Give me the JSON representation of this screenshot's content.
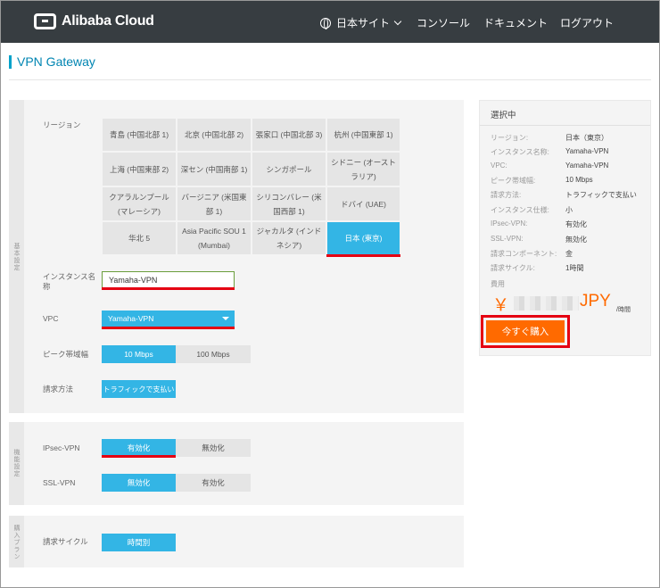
{
  "header": {
    "logo": "Alibaba Cloud",
    "nav": {
      "site": "日本サイト",
      "console": "コンソール",
      "docs": "ドキュメント",
      "logout": "ログアウト"
    }
  },
  "page_title": "VPN Gateway",
  "basic": {
    "section": "基本設定",
    "region_label": "リージョン",
    "regions": [
      "青島 (中国北部 1)",
      "北京 (中国北部 2)",
      "張家口 (中国北部 3)",
      "杭州 (中国東部 1)",
      "上海 (中国東部 2)",
      "深セン (中国南部 1)",
      "シンガポール",
      "シドニー (オーストラリア)",
      "クアラルンプール (マレーシア)",
      "バージニア (米国東部 1)",
      "シリコンバレー (米国西部 1)",
      "ドバイ (UAE)",
      "华北 5",
      "Asia Pacific SOU 1 (Mumbai)",
      "ジャカルタ (インドネシア)",
      "日本 (東京)"
    ],
    "selected_region": "日本 (東京)",
    "instance_label": "インスタンス名称",
    "instance_value": "Yamaha-VPN",
    "vpc_label": "VPC",
    "vpc_value": "Yamaha-VPN",
    "bandwidth_label": "ピーク帯域幅",
    "bandwidth_options": [
      "10 Mbps",
      "100 Mbps"
    ],
    "billing_label": "請求方法",
    "billing_value": "トラフィックで支払い"
  },
  "features": {
    "section": "機能設定",
    "ipsec_label": "IPsec-VPN",
    "ipsec_on": "有効化",
    "ipsec_off": "無効化",
    "ssl_label": "SSL-VPN",
    "ssl_off": "無効化",
    "ssl_on": "有効化"
  },
  "plan": {
    "section": "購入プラン",
    "cycle_label": "請求サイクル",
    "cycle_value": "時間別"
  },
  "summary": {
    "title": "選択中",
    "rows": [
      {
        "k": "リージョン:",
        "v": "日本（東京）"
      },
      {
        "k": "インスタンス名称:",
        "v": "Yamaha-VPN"
      },
      {
        "k": "VPC:",
        "v": "Yamaha-VPN"
      },
      {
        "k": "ピーク帯域幅:",
        "v": "10 Mbps"
      },
      {
        "k": "請求方法:",
        "v": "トラフィックで支払い"
      },
      {
        "k": "インスタンス仕様:",
        "v": "小"
      },
      {
        "k": "IPsec-VPN:",
        "v": "有効化"
      },
      {
        "k": "SSL-VPN:",
        "v": "無効化"
      },
      {
        "k": "請求コンポーネント:",
        "v": "金"
      },
      {
        "k": "請求サイクル:",
        "v": "1時間"
      }
    ],
    "fee_label": "費用",
    "currency_symbol": "￥",
    "currency": "JPY",
    "per_unit": "/時間",
    "buy_label": "今すぐ購入"
  },
  "colors": {
    "accent": "#33b5e5",
    "orange": "#ff6a00",
    "highlight": "#e50012",
    "header": "#373d41"
  }
}
